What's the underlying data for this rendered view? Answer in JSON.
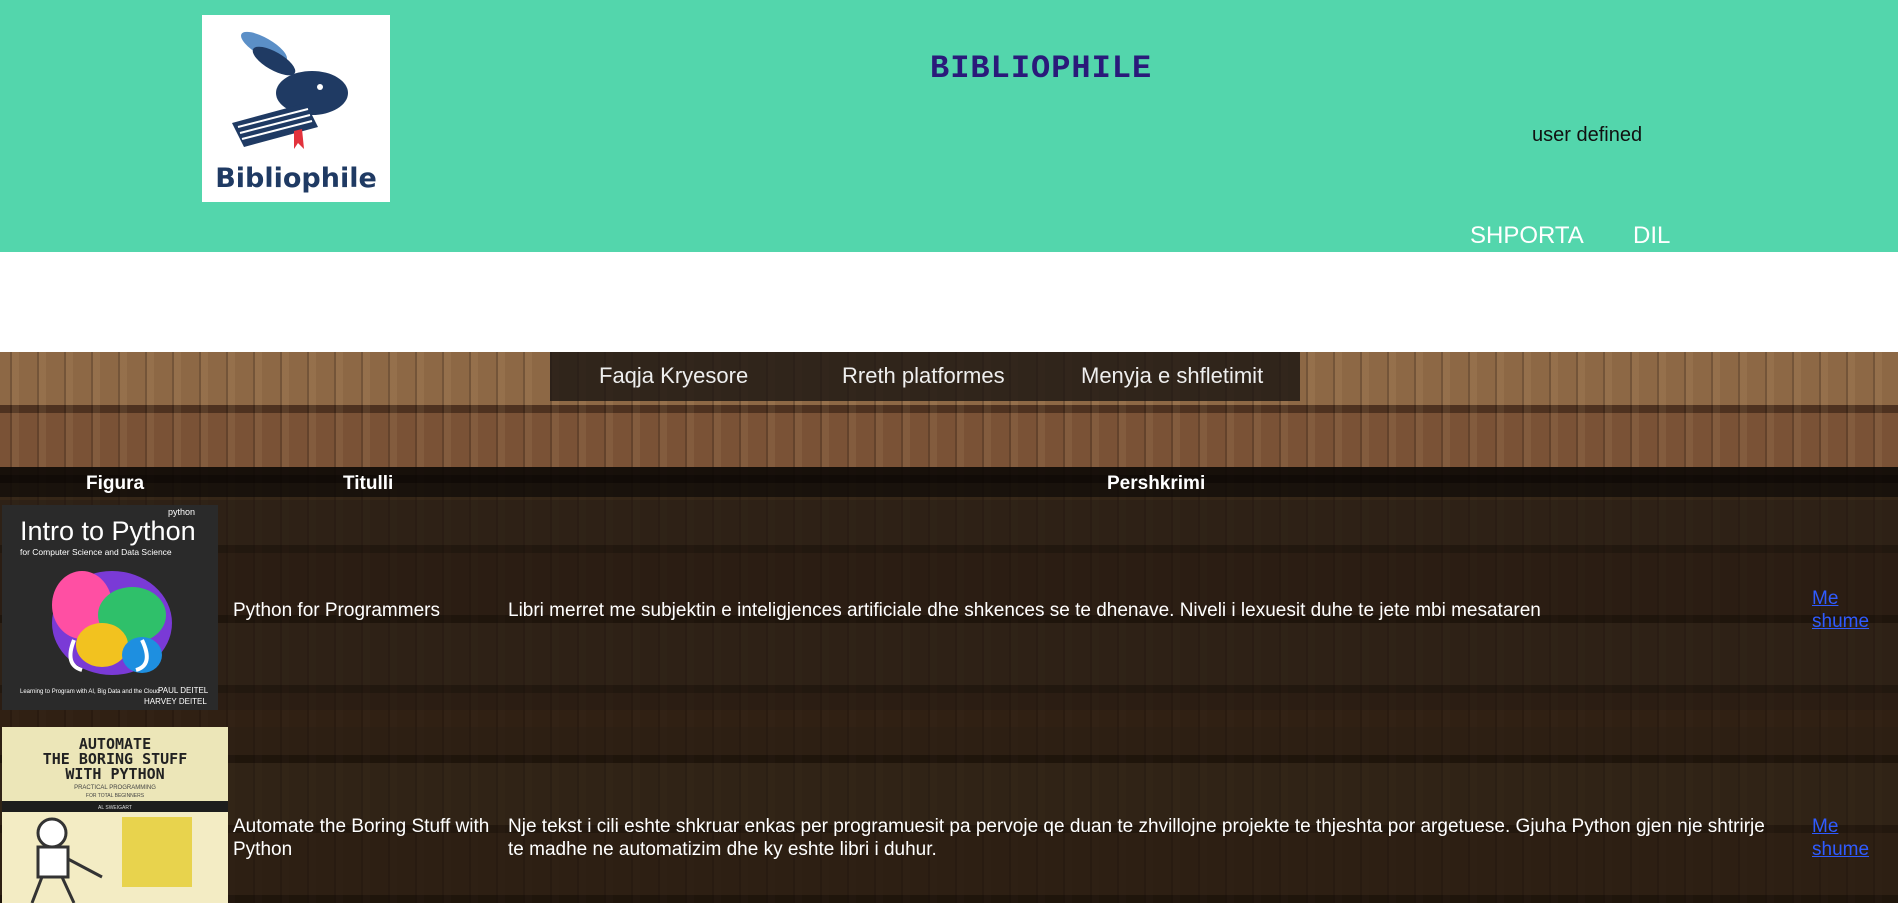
{
  "header": {
    "logo_text": "Bibliophile",
    "site_title": "BIBLIOPHILE",
    "user_label": "user defined",
    "cart_link": "SHPORTA",
    "logout_link": "DIL",
    "background_color": "#53d6ac",
    "title_color": "#2a1a7a"
  },
  "nav": {
    "items": [
      {
        "label": "Faqja Kryesore"
      },
      {
        "label": "Rreth platformes"
      },
      {
        "label": "Menyja e shfletimit"
      }
    ]
  },
  "table": {
    "columns": [
      "Figura",
      "Titulli",
      "Pershkrimi"
    ],
    "rows": [
      {
        "cover_text": [
          "python",
          "Intro to Python",
          "for Computer Science and Data Science",
          "Learning to Program with AI, Big Data and the Cloud",
          "PAUL DEITEL",
          "HARVEY DEITEL"
        ],
        "title": "Python for Programmers",
        "description": "Libri merret me subjektin e inteligjences artificiale dhe shkences se te dhenave. Niveli i lexuesit duhe te jete mbi mesataren",
        "more": "Me shume"
      },
      {
        "cover_text": [
          "AUTOMATE",
          "THE BORING STUFF",
          "WITH PYTHON",
          "PRACTICAL PROGRAMMING",
          "FOR TOTAL BEGINNERS",
          "AL SWEIGART"
        ],
        "title": "Automate the Boring Stuff with Python",
        "description": "Nje tekst i cili eshte shkruar enkas per programuesit pa pervoje qe duan te zhvillojne projekte te thjeshta por argetuese. Gjuha Python gjen nje shtrirje te madhe ne automatizim dhe ky eshte libri i duhur.",
        "more": "Me shume"
      }
    ]
  },
  "link_color": "#2f5bff"
}
